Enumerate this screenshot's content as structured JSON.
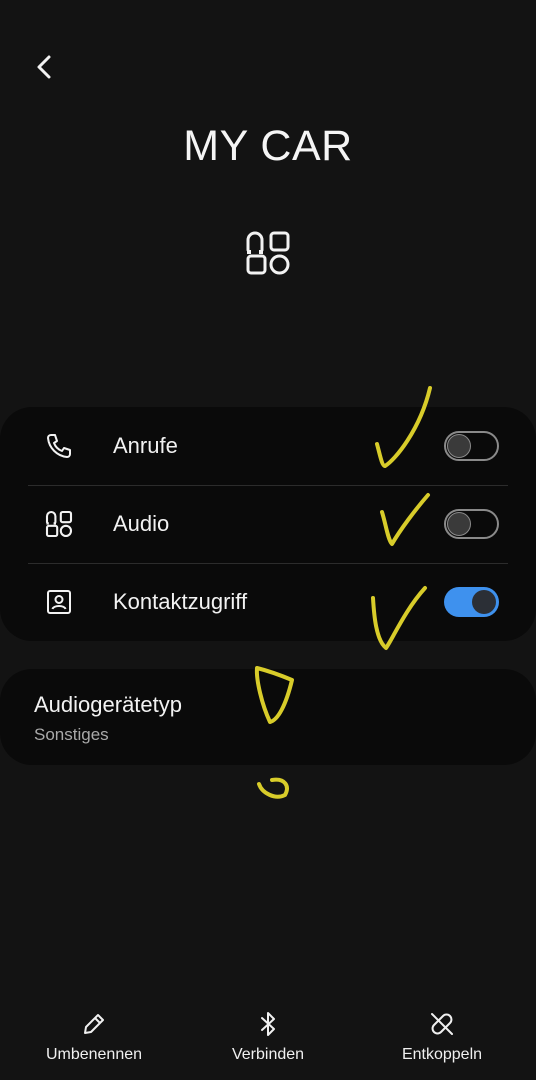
{
  "header": {
    "title": "MY CAR",
    "device_icon": "bluetooth-device-type-icon",
    "back_icon": "chevron-left-icon"
  },
  "settings": [
    {
      "label": "Anrufe",
      "icon": "phone-icon",
      "enabled": false
    },
    {
      "label": "Audio",
      "icon": "audio-device-icon",
      "enabled": false
    },
    {
      "label": "Kontaktzugriff",
      "icon": "contact-card-icon",
      "enabled": true
    }
  ],
  "audio_device_type": {
    "title": "Audiogerätetyp",
    "value": "Sonstiges"
  },
  "bottom_actions": [
    {
      "label": "Umbenennen",
      "icon": "pencil-icon"
    },
    {
      "label": "Verbinden",
      "icon": "bluetooth-icon"
    },
    {
      "label": "Entkoppeln",
      "icon": "unlink-icon"
    }
  ],
  "colors": {
    "background": "#131313",
    "card": "#0a0a0a",
    "accent": "#3e91ee",
    "annotation": "#d8cc2a"
  }
}
